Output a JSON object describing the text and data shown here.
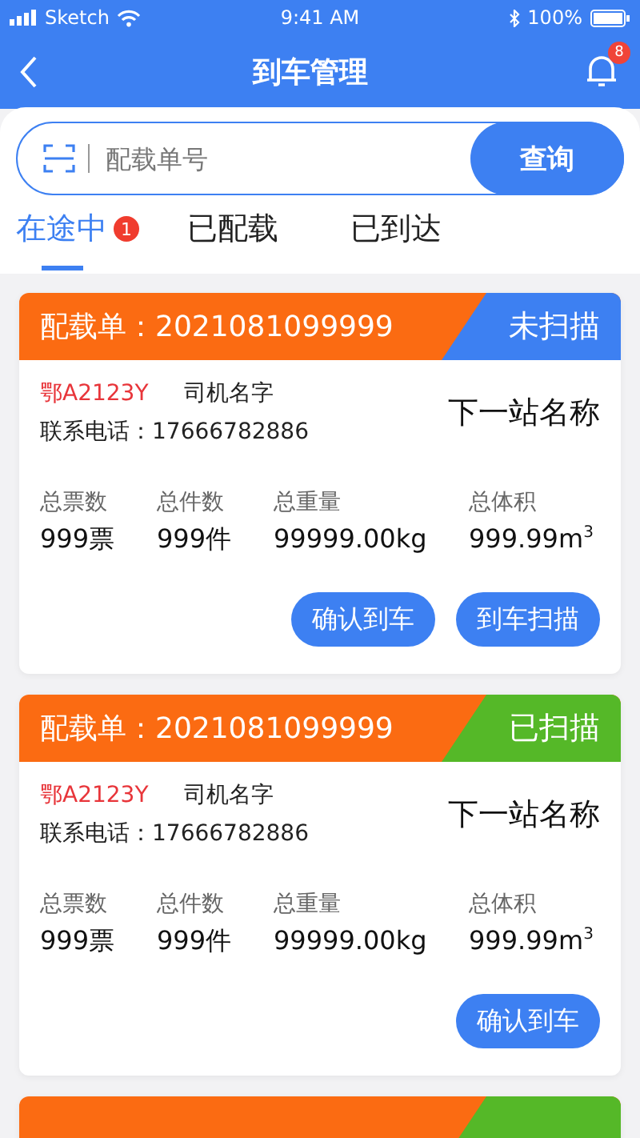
{
  "status_bar": {
    "carrier": "Sketch",
    "time": "9:41 AM",
    "battery": "100%"
  },
  "nav": {
    "title": "到车管理",
    "notification_count": "8"
  },
  "search": {
    "placeholder": "配载单号",
    "button": "查询"
  },
  "tabs": [
    {
      "label": "在途中",
      "badge": "1",
      "selected": true
    },
    {
      "label": "已配载",
      "selected": false
    },
    {
      "label": "已到达",
      "selected": false
    }
  ],
  "cards": [
    {
      "order": "配载单：2021081099999",
      "status": "未扫描",
      "scanned": false,
      "plate": "鄂A2123Y",
      "driver": "司机名字",
      "phone": "联系电话：17666782886",
      "next_station": "下一站名称",
      "stats": [
        {
          "label": "总票数",
          "value": "999票"
        },
        {
          "label": "总件数",
          "value": "999件"
        },
        {
          "label": "总重量",
          "value": "99999.00kg"
        },
        {
          "label": "总体积",
          "value": "999.99m$^{3}$"
        }
      ],
      "buttons": [
        "确认到车",
        "到车扫描"
      ]
    },
    {
      "order": "配载单：2021081099999",
      "status": "已扫描",
      "scanned": true,
      "plate": "鄂A2123Y",
      "driver": "司机名字",
      "phone": "联系电话：17666782886",
      "next_station": "下一站名称",
      "stats": [
        {
          "label": "总票数",
          "value": "999票"
        },
        {
          "label": "总件数",
          "value": "999件"
        },
        {
          "label": "总重量",
          "value": "99999.00kg"
        },
        {
          "label": "总体积",
          "value": "999.99m$^{3}$"
        }
      ],
      "buttons": [
        "确认到车"
      ]
    },
    {
      "scanned": true
    }
  ]
}
